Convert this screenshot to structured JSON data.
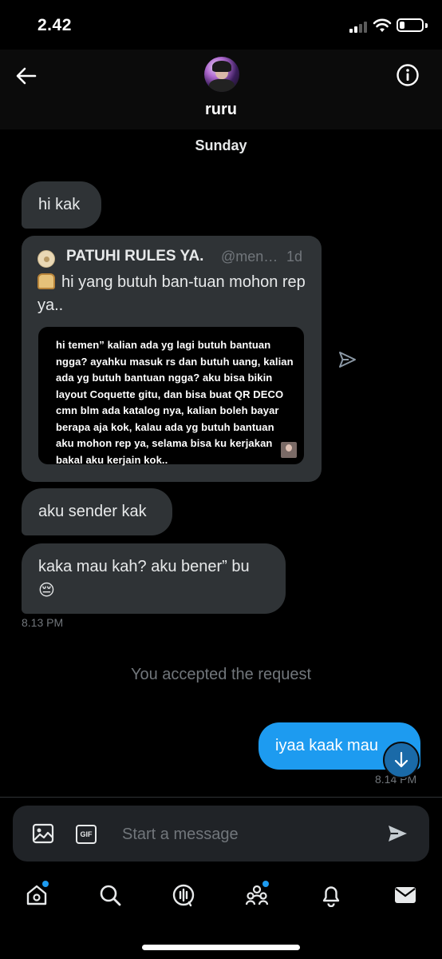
{
  "status_bar": {
    "time": "2.42"
  },
  "header": {
    "name": "ruru"
  },
  "day_label": "Sunday",
  "messages": {
    "m1": "hi kak",
    "m2": "aku sender kak",
    "m3": "kaka mau kah? aku bener” bu",
    "m3_emoji": "😔",
    "sent": "iyaa kaak mau",
    "ts_received": "8.13 PM",
    "ts_sent": "8.14 PM"
  },
  "quote": {
    "name": "PATUHI RULES YA.",
    "handle": "@men…",
    "time": "1d",
    "text": "hi yang butuh ban-tuan mohon rep ya..",
    "card_text": "hi temen” kalian ada yg lagi butuh bantuan ngga? ayahku masuk rs dan butuh uang, kalian ada yg butuh bantuan ngga? aku bisa bikin layout Coquette gitu, dan bisa buat QR DECO cmn blm ada katalog nya, kalian boleh bayar berapa aja kok, kalau ada yg butuh bantuan aku mohon rep ya, selama bisa ku kerjakan bakal aku kerjain kok.."
  },
  "system_notice": "You accepted the request",
  "composer": {
    "placeholder": "Start a message",
    "gif_label": "GIF"
  },
  "tabbar": [
    "home-icon",
    "search-icon",
    "spaces-icon",
    "communities-icon",
    "notifications-icon",
    "messages-icon"
  ],
  "colors": {
    "accent": "#1d9bf0",
    "bubble": "#2f3336",
    "muted": "#71767b"
  }
}
